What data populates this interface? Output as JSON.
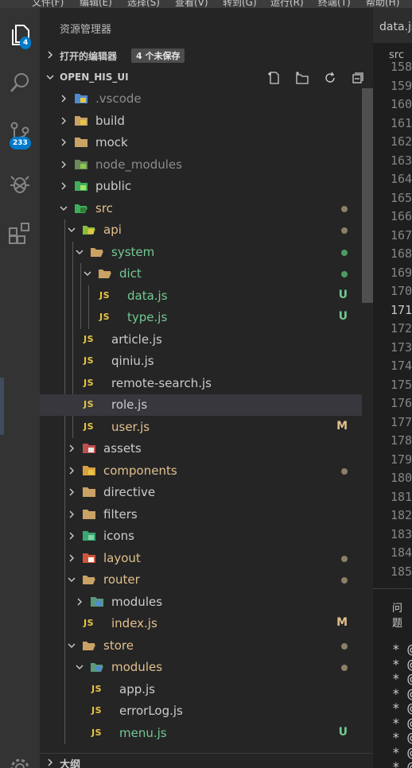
{
  "menubar": {
    "items": [
      "文件(F)",
      "编辑(E)",
      "选择(S)",
      "查看(V)",
      "转到(G)",
      "运行(R)",
      "终端(T)",
      "帮助(H)"
    ]
  },
  "activity_bar": {
    "items": [
      {
        "name": "explorer",
        "icon": "files-icon",
        "badge": "4"
      },
      {
        "name": "search",
        "icon": "search-icon",
        "badge": ""
      },
      {
        "name": "source-control",
        "icon": "source-control-icon",
        "badge": "233"
      },
      {
        "name": "debug",
        "icon": "debug-icon",
        "badge": ""
      },
      {
        "name": "extensions",
        "icon": "extensions-icon",
        "badge": ""
      }
    ],
    "settings_icon": "gear-icon"
  },
  "sidebar": {
    "title": "资源管理器",
    "open_editors": {
      "label": "打开的编辑器",
      "unsaved": "4 个未保存"
    },
    "workspace": {
      "label": "OPEN_HIS_UI"
    },
    "outline": {
      "label": "大纲"
    },
    "colors": {
      "modified": "#e2c08d",
      "untracked": "#73c991",
      "dot": "#8c7f65",
      "ignored": "#8c8c8c",
      "normal": "#cccccc"
    },
    "tree": [
      {
        "name": ".vscode",
        "type": "folder",
        "open": false,
        "depth": 0,
        "icon": "vscode-folder-icon",
        "color": "ignored",
        "deco": ""
      },
      {
        "name": "build",
        "type": "folder",
        "open": false,
        "depth": 0,
        "icon": "build-folder-icon",
        "color": "normal",
        "deco": ""
      },
      {
        "name": "mock",
        "type": "folder",
        "open": false,
        "depth": 0,
        "icon": "folder-icon",
        "color": "normal",
        "deco": ""
      },
      {
        "name": "node_modules",
        "type": "folder",
        "open": false,
        "depth": 0,
        "icon": "node-folder-icon",
        "color": "ignored",
        "deco": ""
      },
      {
        "name": "public",
        "type": "folder",
        "open": false,
        "depth": 0,
        "icon": "public-folder-icon",
        "color": "normal",
        "deco": ""
      },
      {
        "name": "src",
        "type": "folder",
        "open": true,
        "depth": 0,
        "icon": "src-folder-icon",
        "color": "modified",
        "deco": "dot"
      },
      {
        "name": "api",
        "type": "folder",
        "open": true,
        "depth": 1,
        "icon": "api-folder-icon",
        "color": "modified",
        "deco": "dot"
      },
      {
        "name": "system",
        "type": "folder",
        "open": true,
        "depth": 2,
        "icon": "folder-open-icon",
        "color": "untracked",
        "deco": "dot-green"
      },
      {
        "name": "dict",
        "type": "folder",
        "open": true,
        "depth": 3,
        "icon": "folder-open-icon",
        "color": "untracked",
        "deco": "dot-green"
      },
      {
        "name": "data.js",
        "type": "js",
        "depth": 4,
        "icon": "js-file-icon",
        "color": "untracked",
        "deco": "U"
      },
      {
        "name": "type.js",
        "type": "js",
        "depth": 4,
        "icon": "js-file-icon",
        "color": "untracked",
        "deco": "U"
      },
      {
        "name": "article.js",
        "type": "js",
        "depth": 2,
        "icon": "js-file-icon",
        "color": "normal",
        "deco": ""
      },
      {
        "name": "qiniu.js",
        "type": "js",
        "depth": 2,
        "icon": "js-file-icon",
        "color": "normal",
        "deco": ""
      },
      {
        "name": "remote-search.js",
        "type": "js",
        "depth": 2,
        "icon": "js-file-icon",
        "color": "normal",
        "deco": ""
      },
      {
        "name": "role.js",
        "type": "js",
        "depth": 2,
        "icon": "js-file-icon",
        "color": "normal",
        "deco": "",
        "selected": true
      },
      {
        "name": "user.js",
        "type": "js",
        "depth": 2,
        "icon": "js-file-icon",
        "color": "modified",
        "deco": "M"
      },
      {
        "name": "assets",
        "type": "folder",
        "open": false,
        "depth": 1,
        "icon": "assets-folder-icon",
        "color": "normal",
        "deco": ""
      },
      {
        "name": "components",
        "type": "folder",
        "open": false,
        "depth": 1,
        "icon": "components-folder-icon",
        "color": "modified",
        "deco": "dot"
      },
      {
        "name": "directive",
        "type": "folder",
        "open": false,
        "depth": 1,
        "icon": "folder-icon",
        "color": "normal",
        "deco": ""
      },
      {
        "name": "filters",
        "type": "folder",
        "open": false,
        "depth": 1,
        "icon": "folder-icon",
        "color": "normal",
        "deco": ""
      },
      {
        "name": "icons",
        "type": "folder",
        "open": false,
        "depth": 1,
        "icon": "images-folder-icon",
        "color": "normal",
        "deco": ""
      },
      {
        "name": "layout",
        "type": "folder",
        "open": false,
        "depth": 1,
        "icon": "layout-folder-icon",
        "color": "modified",
        "deco": "dot"
      },
      {
        "name": "router",
        "type": "folder",
        "open": true,
        "depth": 1,
        "icon": "folder-open-icon",
        "color": "modified",
        "deco": "dot"
      },
      {
        "name": "modules",
        "type": "folder",
        "open": false,
        "depth": 2,
        "icon": "modules-folder-icon",
        "color": "normal",
        "deco": ""
      },
      {
        "name": "index.js",
        "type": "js",
        "depth": 2,
        "icon": "js-file-icon",
        "color": "modified",
        "deco": "M"
      },
      {
        "name": "store",
        "type": "folder",
        "open": true,
        "depth": 1,
        "icon": "folder-open-icon",
        "color": "modified",
        "deco": "dot"
      },
      {
        "name": "modules",
        "type": "folder",
        "open": true,
        "depth": 2,
        "icon": "modules-folder-open-icon",
        "color": "modified",
        "deco": "dot"
      },
      {
        "name": "app.js",
        "type": "js",
        "depth": 3,
        "icon": "js-file-icon",
        "color": "normal",
        "deco": ""
      },
      {
        "name": "errorLog.js",
        "type": "js",
        "depth": 3,
        "icon": "js-file-icon",
        "color": "normal",
        "deco": ""
      },
      {
        "name": "menu.js",
        "type": "js",
        "depth": 3,
        "icon": "js-file-icon",
        "color": "untracked",
        "deco": "U"
      }
    ]
  },
  "editor": {
    "tab_label": "data.js",
    "breadcrumb": "src",
    "line_numbers": [
      "158",
      "159",
      "160",
      "161",
      "162",
      "163",
      "164",
      "165",
      "166",
      "167",
      "168",
      "169",
      "170",
      "171",
      "172",
      "173",
      "174",
      "175",
      "176",
      "177",
      "178",
      "179",
      "180",
      "181",
      "182",
      "183",
      "184",
      "185"
    ],
    "active_line": "171",
    "panel_title": "问题",
    "terminal_lines": [
      "* @",
      "* @",
      "* @",
      "* @",
      "* @",
      "* @",
      "* @",
      "* @",
      "* @"
    ]
  }
}
